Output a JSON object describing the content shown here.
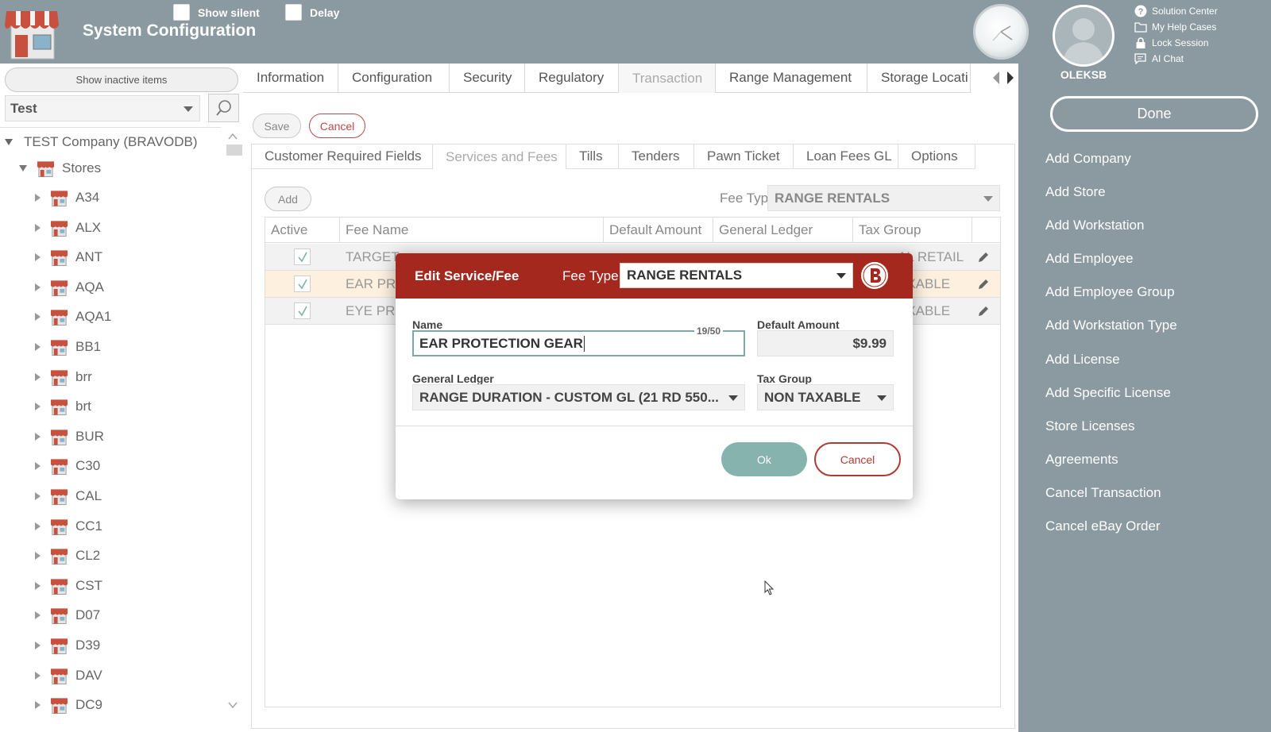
{
  "header": {
    "title": "System Configuration",
    "show_silent_label": "Show silent",
    "delay_label": "Delay"
  },
  "user": {
    "name": "OLEKSB",
    "links": [
      {
        "icon": "question-icon",
        "label": "Solution Center"
      },
      {
        "icon": "folder-icon",
        "label": "My Help Cases"
      },
      {
        "icon": "lock-icon",
        "label": "Lock Session"
      },
      {
        "icon": "chat-icon",
        "label": "AI Chat"
      }
    ]
  },
  "left_panel": {
    "show_inactive_label": "Show inactive items",
    "company_selected": "Test",
    "tree_root": "TEST Company (BRAVODB)",
    "stores_label": "Stores",
    "stores": [
      "A34",
      "ALX",
      "ANT",
      "AQA",
      "AQA1",
      "BB1",
      "brr",
      "brt",
      "BUR",
      "C30",
      "CAL",
      "CC1",
      "CL2",
      "CST",
      "D07",
      "D39",
      "DAV",
      "DC9"
    ]
  },
  "main": {
    "tabs": [
      "Information",
      "Configuration",
      "Security",
      "Regulatory",
      "Transaction",
      "Range Management",
      "Storage Locati"
    ],
    "active_tab": "Transaction",
    "save_label": "Save",
    "cancel_label": "Cancel",
    "sub_tabs": [
      "Customer Required Fields",
      "Services and Fees",
      "Tills",
      "Tenders",
      "Pawn Ticket",
      "Loan Fees GL",
      "Options"
    ],
    "active_sub_tab": "Services and Fees",
    "add_label": "Add",
    "fee_type_label": "Fee Type",
    "fee_type_value": "RANGE RENTALS",
    "grid": {
      "columns": [
        "Active",
        "Fee Name",
        "Default Amount",
        "General Ledger",
        "Tax Group"
      ],
      "rows": [
        {
          "active": true,
          "name": "TARGET",
          "tax": "AL RETAIL"
        },
        {
          "active": true,
          "name": "EAR PRO",
          "tax": "AXABLE"
        },
        {
          "active": true,
          "name": "EYE PRO",
          "tax": "AXABLE"
        }
      ]
    }
  },
  "right_panel": {
    "done_label": "Done",
    "actions": [
      "Add Company",
      "Add Store",
      "Add Workstation",
      "Add Employee",
      "Add Employee Group",
      "Add Workstation Type",
      "Add License",
      "Add Specific License",
      "Store Licenses",
      "Agreements",
      "Cancel Transaction",
      "Cancel eBay Order"
    ]
  },
  "modal": {
    "title": "Edit Service/Fee",
    "fee_type_label": "Fee Type",
    "fee_type_value": "RANGE RENTALS",
    "name_label": "Name",
    "name_value": "EAR PROTECTION GEAR",
    "char_count": "19/50",
    "default_amount_label": "Default Amount",
    "default_amount_value": "$9.99",
    "general_ledger_label": "General Ledger",
    "general_ledger_value": "RANGE DURATION - CUSTOM GL (21 RD 550...",
    "tax_group_label": "Tax Group",
    "tax_group_value": "NON TAXABLE",
    "ok_label": "Ok",
    "cancel_label": "Cancel"
  },
  "colors": {
    "background": "#8a9aa0",
    "modal_header": "#a5281f",
    "ok_button": "#86b3ad",
    "cancel_accent": "#b33a32",
    "highlight_row": "#fdf0df"
  }
}
